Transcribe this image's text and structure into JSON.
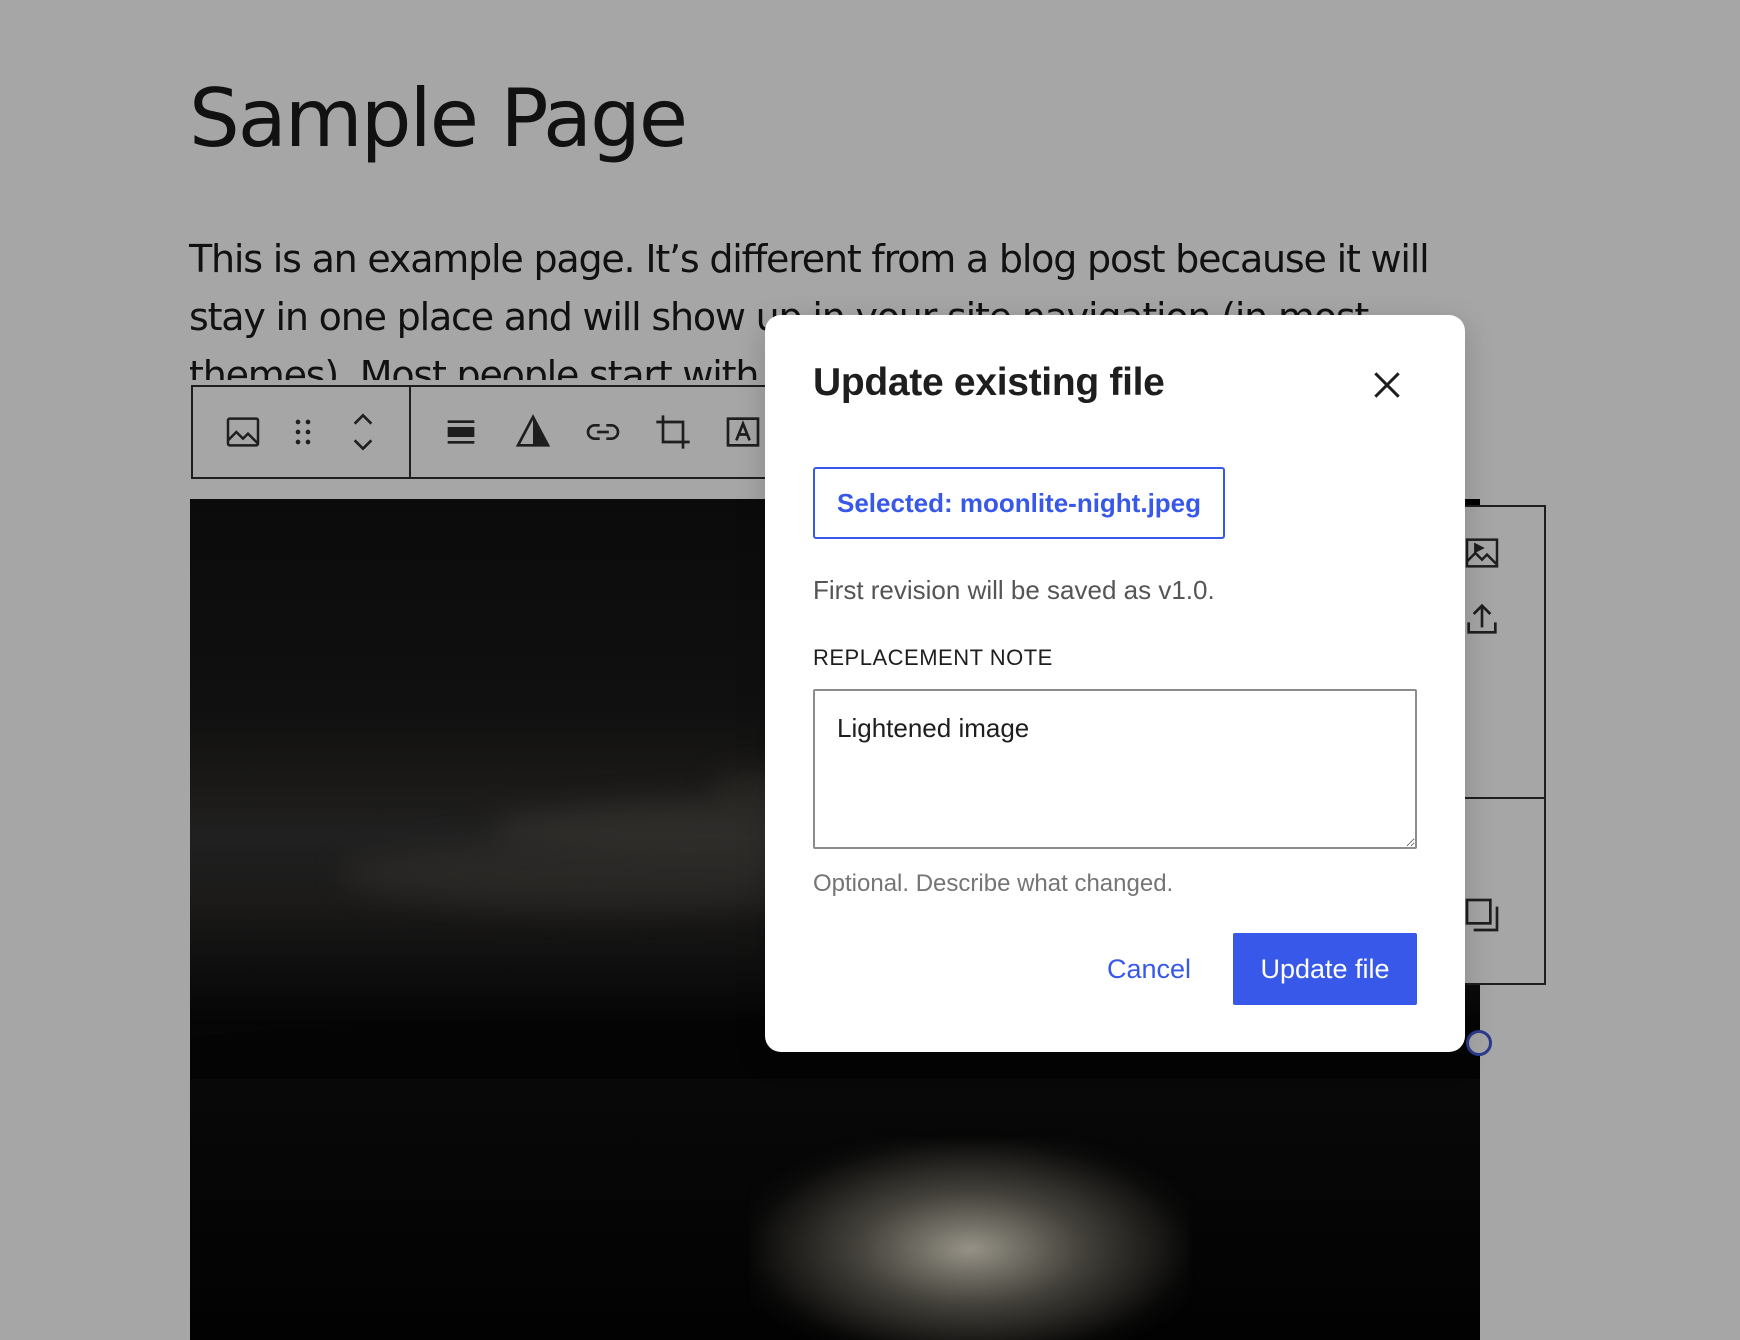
{
  "page": {
    "title": "Sample Page",
    "body": "This is an example page. It’s different from a blog post because it will stay in one place and will show up in your site navigation (in most themes). Most people start with"
  },
  "toolbar": {
    "icons": [
      "image-icon",
      "drag-handle-icon",
      "move-up-down-icon",
      "align-icon",
      "duotone-icon",
      "link-icon",
      "crop-icon",
      "text-overlay-icon"
    ]
  },
  "side_panel": {
    "icons": [
      "media-library-icon",
      "upload-icon",
      "duplicate-icon"
    ]
  },
  "modal": {
    "title": "Update existing file",
    "file_button_label": "Selected: moonlite-night.jpeg",
    "revision_text": "First revision will be saved as v1.0.",
    "note_label": "REPLACEMENT NOTE",
    "note_value": "Lightened image",
    "help_text": "Optional. Describe what changed.",
    "cancel_label": "Cancel",
    "update_label": "Update file"
  },
  "colors": {
    "accent": "#3858e9",
    "overlay": "#a6a6a6",
    "text": "#1e1e1e"
  }
}
